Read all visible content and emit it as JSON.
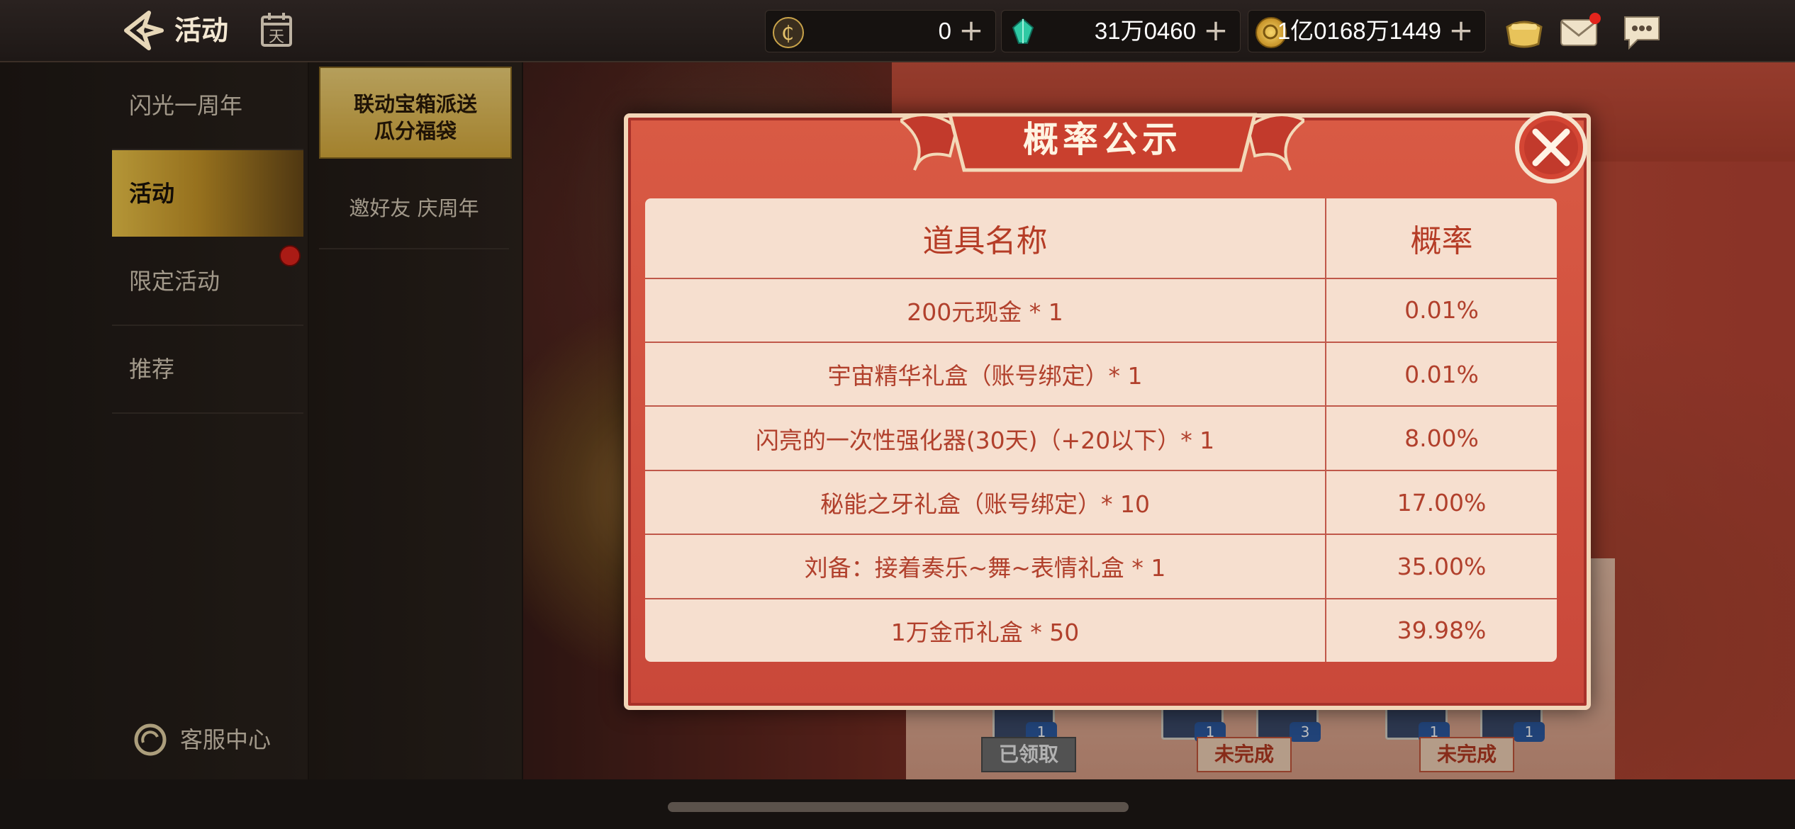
{
  "header": {
    "title": "活动",
    "back_icon": "back-arrow-icon",
    "calendar_icon": "calendar-icon",
    "calendar_glyph": "天"
  },
  "currencies": [
    {
      "name": "coupon",
      "icon": "coupon-icon",
      "value": "0",
      "plus": "+"
    },
    {
      "name": "gem",
      "icon": "gem-icon",
      "value": "31万0460",
      "plus": "+"
    },
    {
      "name": "gold",
      "icon": "gold-coin-icon",
      "value": "1亿0168万1449",
      "plus": "+"
    }
  ],
  "header_actions": [
    "shop-icon",
    "mail-icon",
    "chat-icon"
  ],
  "sidebar": {
    "items": [
      {
        "label": "闪光一周年",
        "active": false
      },
      {
        "label": "活动",
        "active": true
      },
      {
        "label": "限定活动",
        "active": false,
        "badge": true
      },
      {
        "label": "推荐",
        "active": false
      }
    ],
    "service_label": "客服中心"
  },
  "subtabs": {
    "tab1_line1": "联动宝箱派送",
    "tab1_line2": "瓜分福袋",
    "tab2": "邀好友 庆周年"
  },
  "background": {
    "reward_counts": [
      "1",
      "1",
      "3",
      "1",
      "1"
    ],
    "status_buttons": [
      "已领取",
      "未完成",
      "未完成"
    ]
  },
  "modal": {
    "title": "概率公示",
    "headers": [
      "道具名称",
      "概率"
    ],
    "rows": [
      {
        "item": "200元现金 * 1",
        "rate": "0.01%"
      },
      {
        "item": "宇宙精华礼盒（账号绑定）* 1",
        "rate": "0.01%"
      },
      {
        "item": "闪亮的一次性强化器(30天)（+20以下）* 1",
        "rate": "8.00%"
      },
      {
        "item": "秘能之牙礼盒（账号绑定）* 10",
        "rate": "17.00%"
      },
      {
        "item": "刘备：接着奏乐~舞~表情礼盒 * 1",
        "rate": "35.00%"
      },
      {
        "item": "1万金币礼盒 * 50",
        "rate": "39.98%"
      }
    ],
    "close_icon": "close-icon"
  },
  "colors": {
    "accent_gold": "#d9ac3c",
    "modal_red": "#c9483a",
    "table_text": "#b1402c",
    "badge_red": "#e3241c"
  }
}
